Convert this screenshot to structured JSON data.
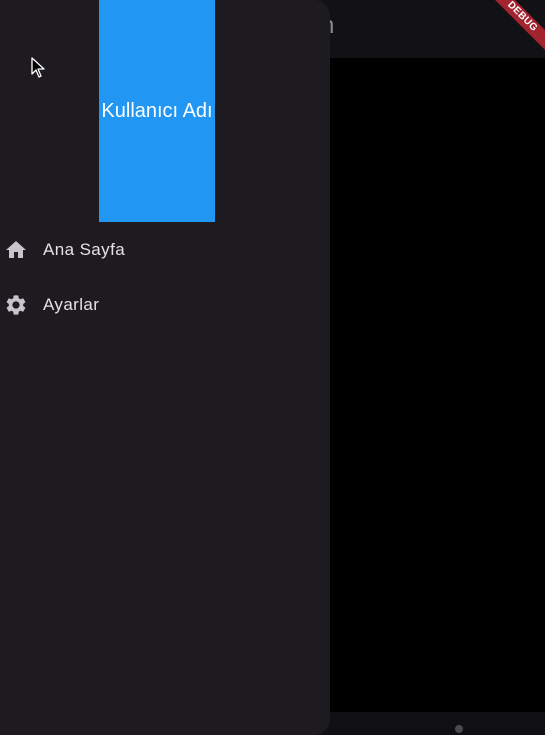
{
  "appbar": {
    "title_fragment": "n"
  },
  "debug_banner": {
    "label": "DEBUG"
  },
  "drawer": {
    "header": {
      "label": "Kullanıcı Adı",
      "color": "#2196f3"
    },
    "items": [
      {
        "label": "Ana Sayfa",
        "icon": "home-icon"
      },
      {
        "label": "Ayarlar",
        "icon": "gear-icon"
      }
    ]
  }
}
